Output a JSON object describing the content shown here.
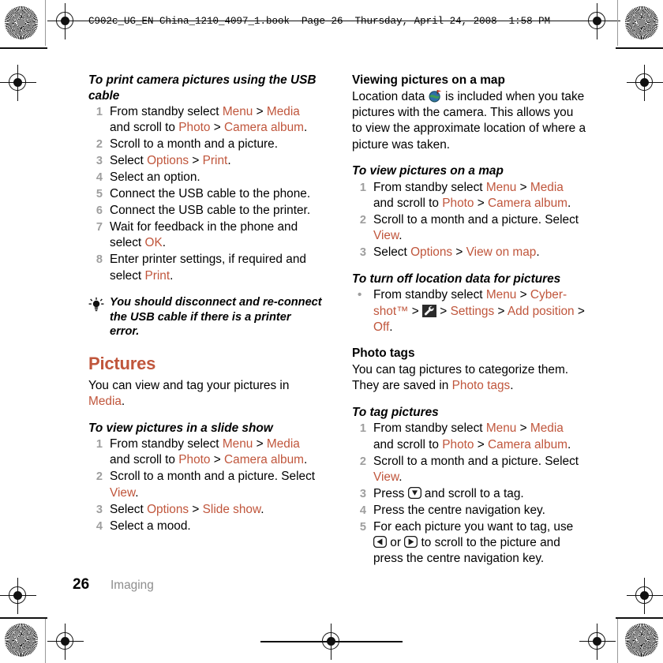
{
  "header": {
    "book_line": "C902c_UG_EN China_1210_4097_1.book  Page 26  Thursday, April 24, 2008  1:58 PM"
  },
  "colors": {
    "accent": "#C0563C",
    "step_number": "#9e9e9e",
    "footer_section": "#8d8d8d",
    "body_text": "#000000"
  },
  "left_column": {
    "heading_print": "To print camera pictures using the USB cable",
    "print_steps": [
      {
        "num": "1",
        "parts": [
          {
            "t": "From standby select ",
            "ui": false
          },
          {
            "t": "Menu",
            "ui": true
          },
          {
            "t": " > ",
            "ui": false
          },
          {
            "t": "Media",
            "ui": true
          },
          {
            "t": " and scroll to ",
            "ui": false
          },
          {
            "t": "Photo",
            "ui": true
          },
          {
            "t": " > ",
            "ui": false
          },
          {
            "t": "Camera album",
            "ui": true
          },
          {
            "t": ".",
            "ui": false
          }
        ]
      },
      {
        "num": "2",
        "parts": [
          {
            "t": "Scroll to a month and a picture.",
            "ui": false
          }
        ]
      },
      {
        "num": "3",
        "parts": [
          {
            "t": "Select ",
            "ui": false
          },
          {
            "t": "Options",
            "ui": true
          },
          {
            "t": " > ",
            "ui": false
          },
          {
            "t": "Print",
            "ui": true
          },
          {
            "t": ".",
            "ui": false
          }
        ]
      },
      {
        "num": "4",
        "parts": [
          {
            "t": "Select an option.",
            "ui": false
          }
        ]
      },
      {
        "num": "5",
        "parts": [
          {
            "t": "Connect the USB cable to the phone.",
            "ui": false
          }
        ]
      },
      {
        "num": "6",
        "parts": [
          {
            "t": "Connect the USB cable to the printer.",
            "ui": false
          }
        ]
      },
      {
        "num": "7",
        "parts": [
          {
            "t": "Wait for feedback in the phone and select ",
            "ui": false
          },
          {
            "t": "OK",
            "ui": true
          },
          {
            "t": ".",
            "ui": false
          }
        ]
      },
      {
        "num": "8",
        "parts": [
          {
            "t": "Enter printer settings, if required and select ",
            "ui": false
          },
          {
            "t": "Print",
            "ui": true
          },
          {
            "t": ".",
            "ui": false
          }
        ]
      }
    ],
    "tip_text": "You should disconnect and re-connect the USB cable if there is a printer error.",
    "tip_icon": "lightbulb-icon",
    "pictures_heading": "Pictures",
    "pictures_intro": [
      {
        "t": "You can view and tag your pictures in ",
        "ui": false
      },
      {
        "t": "Media",
        "ui": true
      },
      {
        "t": ".",
        "ui": false
      }
    ],
    "heading_slideshow": "To view pictures in a slide show",
    "slideshow_steps": [
      {
        "num": "1",
        "parts": [
          {
            "t": "From standby select ",
            "ui": false
          },
          {
            "t": "Menu",
            "ui": true
          },
          {
            "t": " > ",
            "ui": false
          },
          {
            "t": "Media",
            "ui": true
          },
          {
            "t": " and scroll to ",
            "ui": false
          },
          {
            "t": "Photo",
            "ui": true
          },
          {
            "t": " > ",
            "ui": false
          },
          {
            "t": "Camera album",
            "ui": true
          },
          {
            "t": ".",
            "ui": false
          }
        ]
      },
      {
        "num": "2",
        "parts": [
          {
            "t": "Scroll to a month and a picture. Select ",
            "ui": false
          },
          {
            "t": "View",
            "ui": true
          },
          {
            "t": ".",
            "ui": false
          }
        ]
      },
      {
        "num": "3",
        "parts": [
          {
            "t": "Select ",
            "ui": false
          },
          {
            "t": "Options",
            "ui": true
          },
          {
            "t": " > ",
            "ui": false
          },
          {
            "t": "Slide show",
            "ui": true
          },
          {
            "t": ".",
            "ui": false
          }
        ]
      },
      {
        "num": "4",
        "parts": [
          {
            "t": "Select a mood.",
            "ui": false
          }
        ]
      }
    ]
  },
  "right_column": {
    "heading_map": "Viewing pictures on a map",
    "map_intro_before": "Location data ",
    "map_intro_icon": "globe-location-icon",
    "map_intro_after": " is included when you take pictures with the camera. This allows you to view the approximate location of where a picture was taken.",
    "heading_view_map": "To view pictures on a map",
    "view_map_steps": [
      {
        "num": "1",
        "parts": [
          {
            "t": "From standby select ",
            "ui": false
          },
          {
            "t": "Menu",
            "ui": true
          },
          {
            "t": " > ",
            "ui": false
          },
          {
            "t": "Media",
            "ui": true
          },
          {
            "t": " and scroll to ",
            "ui": false
          },
          {
            "t": "Photo",
            "ui": true
          },
          {
            "t": " > ",
            "ui": false
          },
          {
            "t": "Camera album",
            "ui": true
          },
          {
            "t": ".",
            "ui": false
          }
        ]
      },
      {
        "num": "2",
        "parts": [
          {
            "t": "Scroll to a month and a picture. Select ",
            "ui": false
          },
          {
            "t": "View",
            "ui": true
          },
          {
            "t": ".",
            "ui": false
          }
        ]
      },
      {
        "num": "3",
        "parts": [
          {
            "t": "Select ",
            "ui": false
          },
          {
            "t": "Options",
            "ui": true
          },
          {
            "t": " > ",
            "ui": false
          },
          {
            "t": "View on map",
            "ui": true
          },
          {
            "t": ".",
            "ui": false
          }
        ]
      }
    ],
    "heading_turn_off": "To turn off location data for pictures",
    "turn_off_bullet": "•",
    "turn_off_icon": "wrench-settings-icon",
    "turn_off_parts_before": [
      {
        "t": "From standby select ",
        "ui": false
      },
      {
        "t": "Menu",
        "ui": true
      },
      {
        "t": " > ",
        "ui": false
      },
      {
        "t": "Cyber-shot™",
        "ui": true
      },
      {
        "t": " > ",
        "ui": false
      }
    ],
    "turn_off_parts_after": [
      {
        "t": " > ",
        "ui": false
      },
      {
        "t": "Settings",
        "ui": true
      },
      {
        "t": " > ",
        "ui": false
      },
      {
        "t": "Add position",
        "ui": true
      },
      {
        "t": " > ",
        "ui": false
      },
      {
        "t": "Off",
        "ui": true
      },
      {
        "t": ".",
        "ui": false
      }
    ],
    "heading_photo_tags": "Photo tags",
    "photo_tags_intro": [
      {
        "t": "You can tag pictures to categorize them. They are saved in ",
        "ui": false
      },
      {
        "t": "Photo tags",
        "ui": true
      },
      {
        "t": ".",
        "ui": false
      }
    ],
    "heading_tag_pictures": "To tag pictures",
    "tag_steps": [
      {
        "num": "1",
        "parts": [
          {
            "t": "From standby select ",
            "ui": false
          },
          {
            "t": "Menu",
            "ui": true
          },
          {
            "t": " > ",
            "ui": false
          },
          {
            "t": "Media",
            "ui": true
          },
          {
            "t": " and scroll to ",
            "ui": false
          },
          {
            "t": "Photo",
            "ui": true
          },
          {
            "t": " > ",
            "ui": false
          },
          {
            "t": "Camera album",
            "ui": true
          },
          {
            "t": ".",
            "ui": false
          }
        ]
      },
      {
        "num": "2",
        "parts": [
          {
            "t": "Scroll to a month and a picture. Select ",
            "ui": false
          },
          {
            "t": "View",
            "ui": true
          },
          {
            "t": ".",
            "ui": false
          }
        ]
      },
      {
        "num": "4",
        "parts": [
          {
            "t": "Press the centre navigation key.",
            "ui": false
          }
        ]
      }
    ],
    "step3_before": "Press ",
    "step3_icon": "nav-key-down-icon",
    "step3_after": " and scroll to a tag.",
    "step3_num": "3",
    "step5_num": "5",
    "step5_before": "For each picture you want to tag, use ",
    "step5_icon_left": "nav-key-left-icon",
    "step5_mid": " or ",
    "step5_icon_right": "nav-key-right-icon",
    "step5_after": " to scroll to the picture and press the centre navigation key."
  },
  "footer": {
    "page_number": "26",
    "section": "Imaging"
  }
}
